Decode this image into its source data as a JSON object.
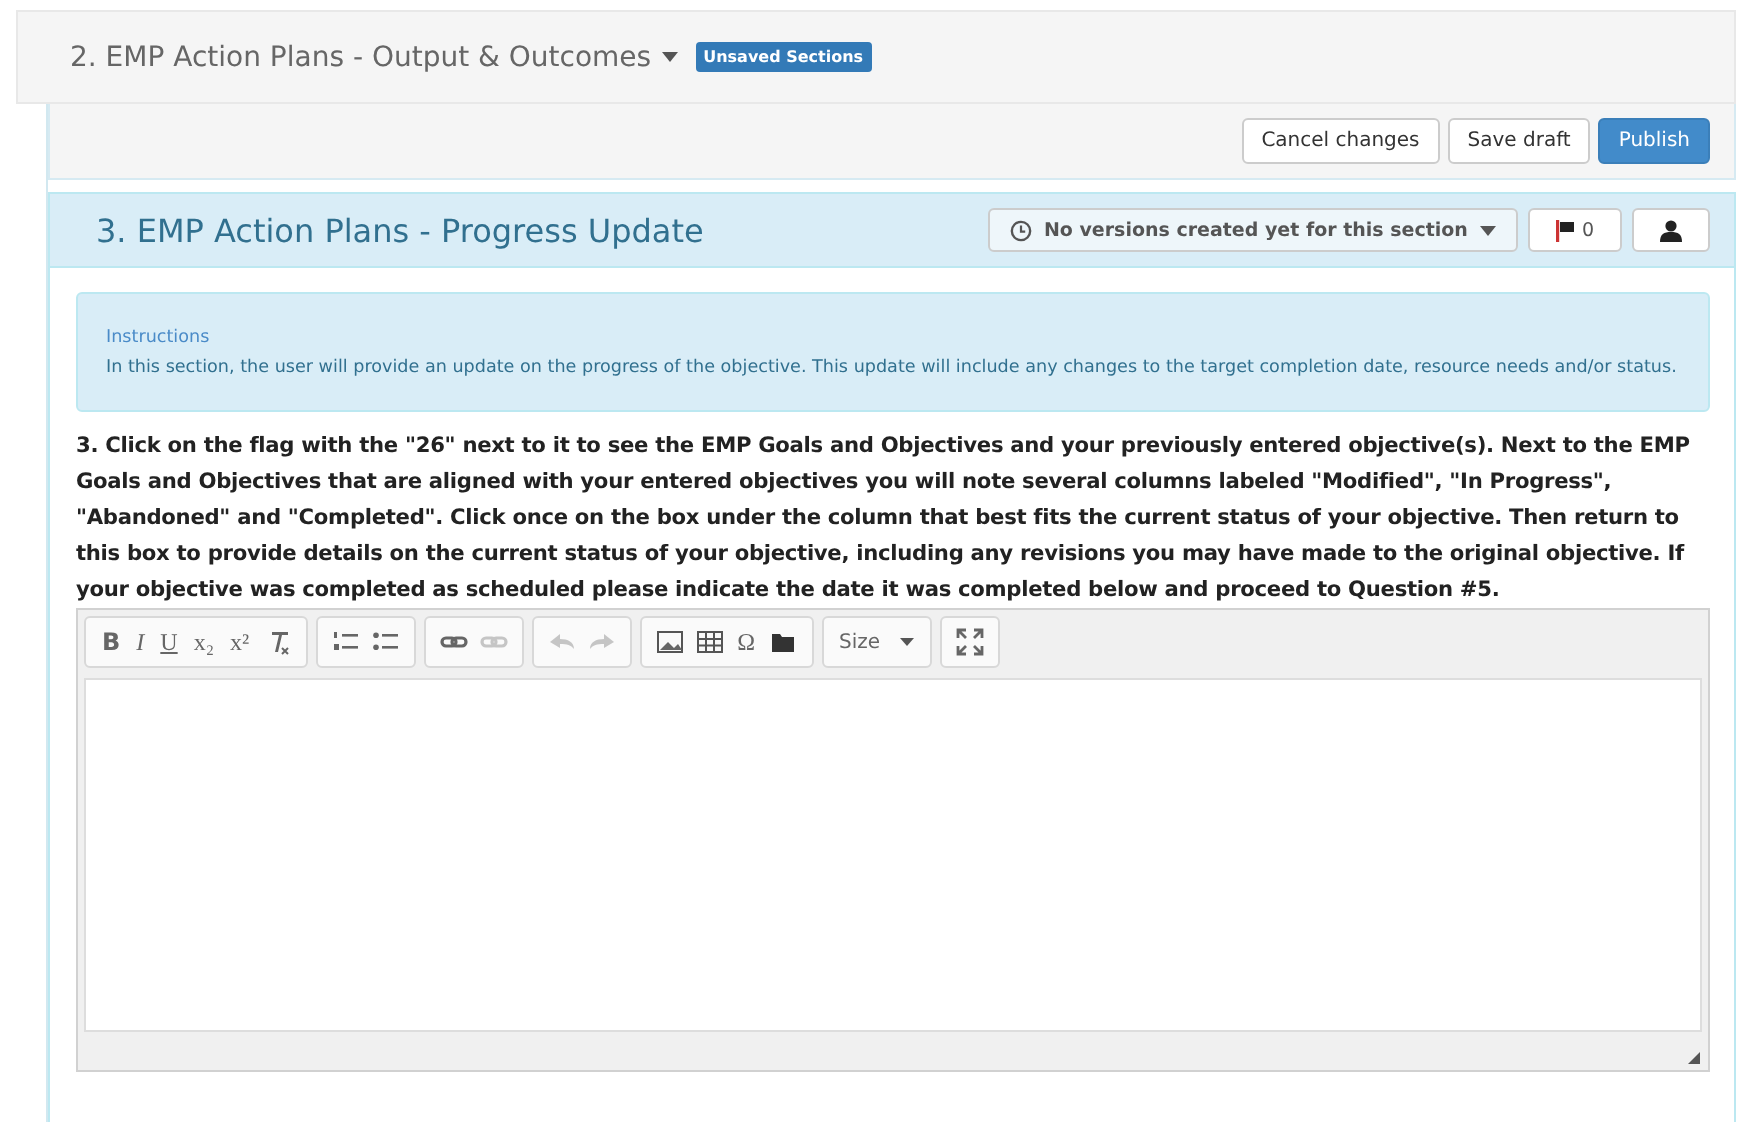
{
  "top_section": {
    "title": "2. EMP Action Plans - Output & Outcomes",
    "badge": "Unsaved Sections"
  },
  "actions": [
    {
      "label": "Cancel changes",
      "primary": false
    },
    {
      "label": "Save draft",
      "primary": false
    },
    {
      "label": "Publish",
      "primary": true
    }
  ],
  "section": {
    "title": "3. EMP Action Plans - Progress Update",
    "versions_label": "No versions created yet for this section",
    "flag_count": "0"
  },
  "instructions": {
    "heading": "Instructions",
    "text": "In this section, the user will provide an update on the progress of the objective. This update will include any changes to the target completion date, resource needs and/or status."
  },
  "question": "3. Click on the flag with the \"26\" next to it to see the EMP Goals and Objectives and your previously entered objective(s). Next to the EMP Goals and Objectives that are aligned with your entered objectives you will note several columns labeled \"Modified\", \"In Progress\", \"Abandoned\" and \"Completed\". Click once on the box under the column that best fits the current status of your objective. Then return to this box to provide details on the current status of your objective, including any revisions you may have made to the original objective. If your objective was completed as scheduled please indicate the date it was completed below and proceed to Question #5.",
  "toolbar": [
    [
      {
        "kind": "bold",
        "glyph": "B",
        "disabled": false
      },
      {
        "kind": "italic",
        "glyph": "I",
        "disabled": false
      },
      {
        "kind": "underline",
        "glyph": "U",
        "disabled": false
      },
      {
        "kind": "glyph",
        "glyph": "x₂",
        "disabled": false
      },
      {
        "kind": "glyph",
        "glyph": "x²",
        "disabled": false
      },
      {
        "kind": "clear",
        "disabled": false
      }
    ],
    [
      {
        "kind": "numbered",
        "disabled": false
      },
      {
        "kind": "bulleted",
        "disabled": false
      }
    ],
    [
      {
        "kind": "link",
        "disabled": false
      },
      {
        "kind": "unlink",
        "disabled": true
      }
    ],
    [
      {
        "kind": "undo",
        "disabled": true
      },
      {
        "kind": "redo",
        "disabled": true
      }
    ],
    [
      {
        "kind": "image",
        "disabled": false
      },
      {
        "kind": "table",
        "disabled": false
      },
      {
        "kind": "glyph",
        "glyph": "Ω",
        "disabled": false
      },
      {
        "kind": "folder",
        "disabled": false
      }
    ],
    [
      {
        "kind": "dropdown",
        "label": "Size",
        "disabled": false
      }
    ],
    [
      {
        "kind": "maximize",
        "disabled": false
      }
    ]
  ]
}
